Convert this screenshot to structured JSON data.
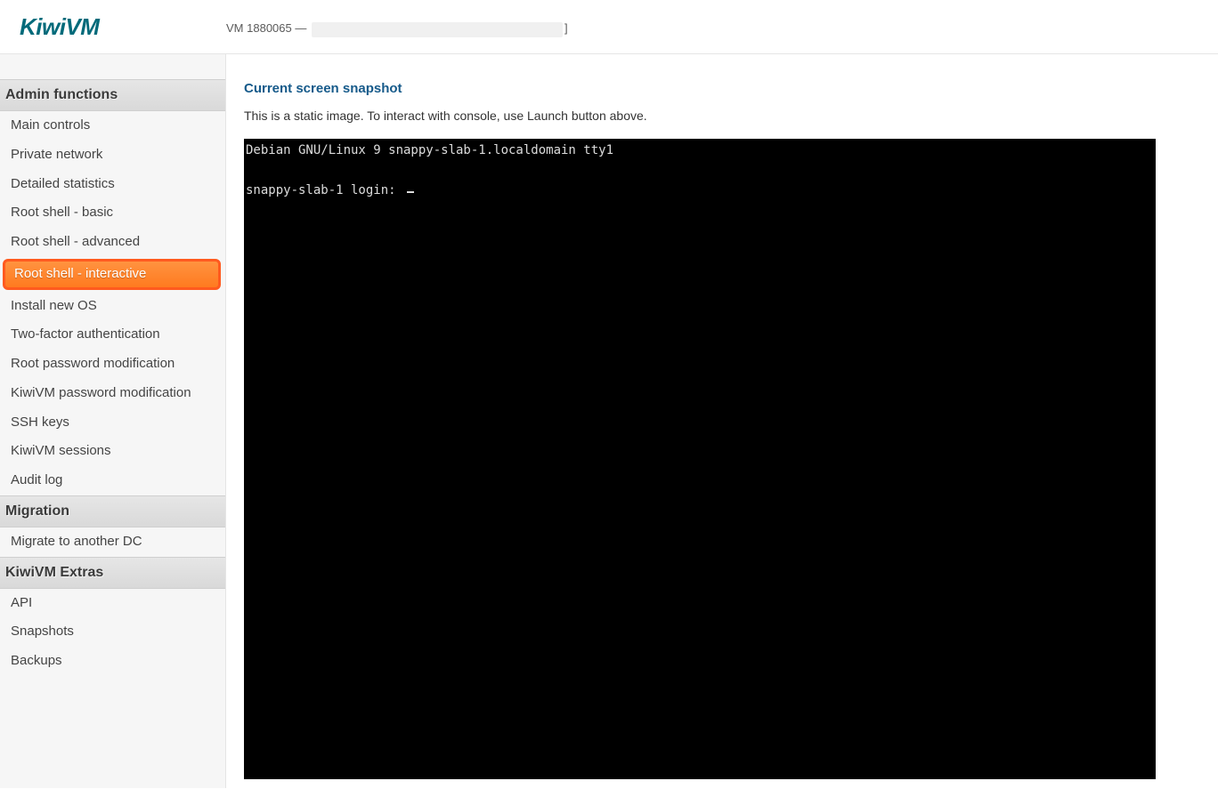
{
  "header": {
    "logo": "KiwiVM",
    "vm_label_prefix": "VM ",
    "vm_id": "1880065",
    "vm_label_sep": " — ",
    "vm_label_suffix": "]"
  },
  "sidebar": {
    "sections": [
      {
        "title": "Admin functions",
        "items": [
          {
            "label": "Main controls"
          },
          {
            "label": "Private network"
          },
          {
            "label": "Detailed statistics"
          },
          {
            "label": "Root shell - basic"
          },
          {
            "label": "Root shell - advanced"
          },
          {
            "label": "Root shell - interactive",
            "highlighted": true
          },
          {
            "label": "Install new OS"
          },
          {
            "label": "Two-factor authentication"
          },
          {
            "label": "Root password modification"
          },
          {
            "label": "KiwiVM password modification"
          },
          {
            "label": "SSH keys"
          },
          {
            "label": "KiwiVM sessions"
          },
          {
            "label": "Audit log"
          }
        ]
      },
      {
        "title": "Migration",
        "items": [
          {
            "label": "Migrate to another DC"
          }
        ]
      },
      {
        "title": "KiwiVM Extras",
        "items": [
          {
            "label": "API"
          },
          {
            "label": "Snapshots"
          },
          {
            "label": "Backups"
          }
        ]
      }
    ]
  },
  "main": {
    "heading": "Current screen snapshot",
    "subtext": "This is a static image. To interact with console, use Launch button above.",
    "console": {
      "line1": "Debian GNU/Linux 9 snappy-slab-1.localdomain tty1",
      "line2": "snappy-slab-1 login:"
    }
  }
}
